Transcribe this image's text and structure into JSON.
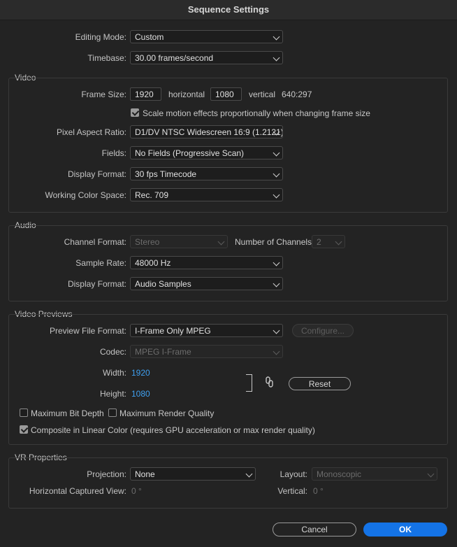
{
  "window": {
    "title": "Sequence Settings"
  },
  "general": {
    "editing_mode_label": "Editing Mode:",
    "editing_mode_value": "Custom",
    "timebase_label": "Timebase:",
    "timebase_value": "30.00  frames/second"
  },
  "video": {
    "section_label": "Video",
    "frame_size_label": "Frame Size:",
    "frame_width": "1920",
    "horizontal_label": "horizontal",
    "frame_height": "1080",
    "vertical_label": "vertical",
    "aspect_ratio_text": "640:297",
    "scale_motion_label": "Scale motion effects proportionally when changing frame size",
    "scale_motion_checked": true,
    "pixel_aspect_label": "Pixel Aspect Ratio:",
    "pixel_aspect_value": "D1/DV NTSC Widescreen 16:9 (1.2121)",
    "fields_label": "Fields:",
    "fields_value": "No Fields (Progressive Scan)",
    "display_format_label": "Display Format:",
    "display_format_value": "30 fps Timecode",
    "color_space_label": "Working Color Space:",
    "color_space_value": "Rec. 709"
  },
  "audio": {
    "section_label": "Audio",
    "channel_format_label": "Channel Format:",
    "channel_format_value": "Stereo",
    "num_channels_label": "Number of Channels:",
    "num_channels_value": "2",
    "sample_rate_label": "Sample Rate:",
    "sample_rate_value": "48000 Hz",
    "display_format_label": "Display Format:",
    "display_format_value": "Audio Samples"
  },
  "previews": {
    "section_label": "Video Previews",
    "file_format_label": "Preview File Format:",
    "file_format_value": "I-Frame Only MPEG",
    "configure_label": "Configure...",
    "codec_label": "Codec:",
    "codec_value": "MPEG I-Frame",
    "width_label": "Width:",
    "width_value": "1920",
    "height_label": "Height:",
    "height_value": "1080",
    "reset_label": "Reset",
    "max_bit_depth_label": "Maximum Bit Depth",
    "max_bit_depth_checked": false,
    "max_render_quality_label": "Maximum Render Quality",
    "max_render_quality_checked": false,
    "linear_color_label": "Composite in Linear Color (requires GPU acceleration or max render quality)",
    "linear_color_checked": true
  },
  "vr": {
    "section_label": "VR Properties",
    "projection_label": "Projection:",
    "projection_value": "None",
    "layout_label": "Layout:",
    "layout_value": "Monoscopic",
    "h_captured_label": "Horizontal Captured View:",
    "h_captured_value": "0 °",
    "vertical_label": "Vertical:",
    "vertical_value": "0 °"
  },
  "footer": {
    "cancel_label": "Cancel",
    "ok_label": "OK"
  },
  "colors": {
    "accent": "#1473e6",
    "link_value": "#3fa0f0",
    "background": "#232323"
  }
}
